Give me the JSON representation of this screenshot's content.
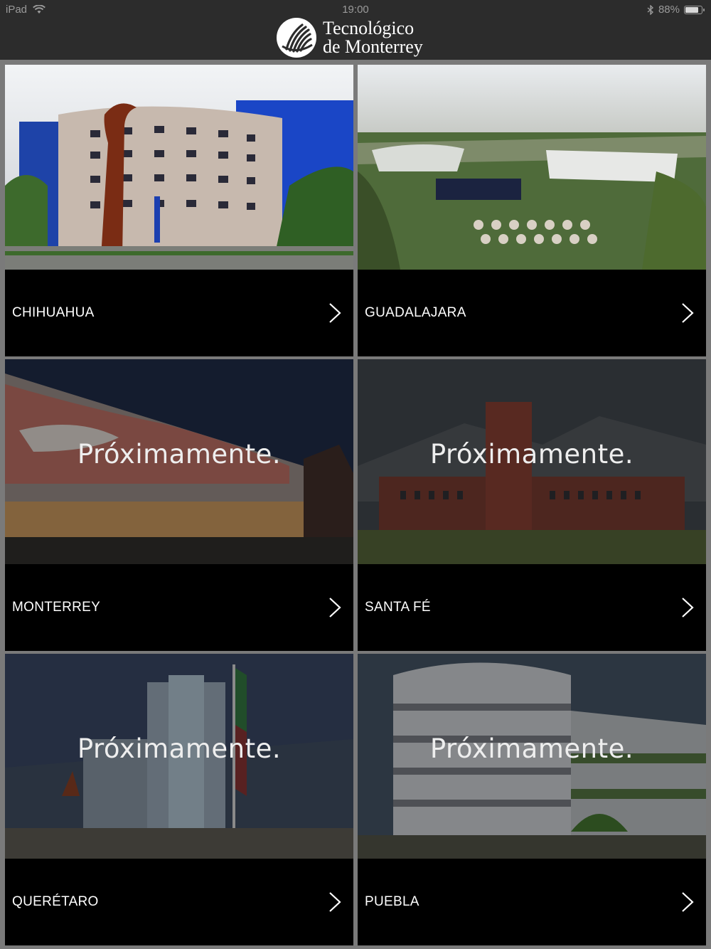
{
  "status_bar": {
    "device": "iPad",
    "time": "19:00",
    "battery": "88%",
    "battery_level": 0.88
  },
  "header": {
    "brand_line1": "Tecnológico",
    "brand_line2": "de Monterrey"
  },
  "campuses": [
    {
      "name": "CHIHUAHUA",
      "overlay": ""
    },
    {
      "name": "GUADALAJARA",
      "overlay": ""
    },
    {
      "name": "MONTERREY",
      "overlay": "Próximamente."
    },
    {
      "name": "SANTA FÉ",
      "overlay": "Próximamente."
    },
    {
      "name": "QUERÉTARO",
      "overlay": "Próximamente."
    },
    {
      "name": "PUEBLA",
      "overlay": "Próximamente."
    }
  ]
}
